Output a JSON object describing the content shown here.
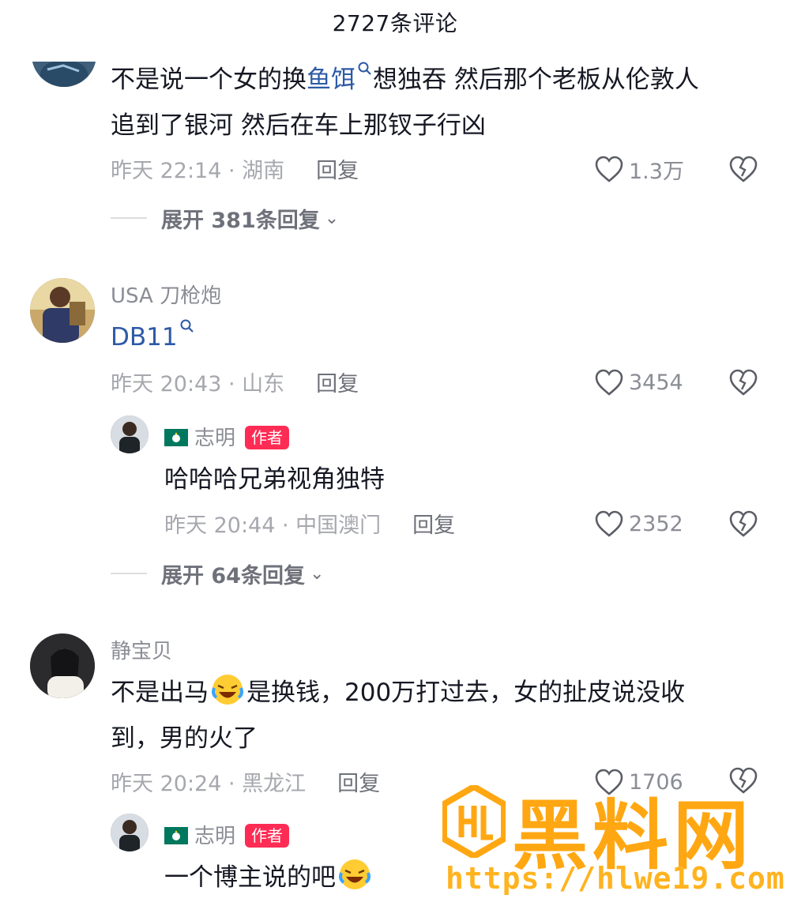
{
  "header": {
    "title": "2727条评论"
  },
  "comments": [
    {
      "text_line1_a": "不是说一个女的换",
      "text_link": "鱼饵",
      "text_line1_b": "想独吞 然后那个老板从伦敦人",
      "text_line2": "追到了银河 然后在车上那钗子行凶",
      "time": "昨天 22:14 · 湖南",
      "reply": "回复",
      "likes": "1.3万",
      "expand": "展开 381条回复"
    },
    {
      "username": "USA 刀枪炮",
      "text_link": "DB11",
      "time": "昨天 20:43 · 山东",
      "reply": "回复",
      "likes": "3454",
      "sub_reply": {
        "username": "志明",
        "badge": "作者",
        "text": "哈哈哈兄弟视角独特",
        "time": "昨天 20:44 · 中国澳门",
        "reply": "回复",
        "likes": "2352"
      },
      "expand": "展开 64条回复"
    },
    {
      "username": "静宝贝",
      "text_line1_a": "不是出马",
      "text_line1_b": "是换钱，200万打过去，女的扯皮说没收",
      "text_line2": "到，男的火了",
      "time": "昨天 20:24 · 黑龙江",
      "reply": "回复",
      "likes": "1706",
      "sub_reply": {
        "username": "志明",
        "badge": "作者",
        "text": "一个博主说的吧"
      }
    }
  ],
  "watermark": {
    "brand": "黑料网",
    "url": "https://hlwe19.com"
  },
  "colors": {
    "link": "#2d5aa6",
    "badge": "#fe2c55",
    "watermark": "#ffa712"
  },
  "icons": [
    "heart-icon",
    "broken-heart-icon",
    "search-mark-icon",
    "laughing-crying-emoji",
    "macau-flag-icon",
    "chevron-down-icon"
  ]
}
